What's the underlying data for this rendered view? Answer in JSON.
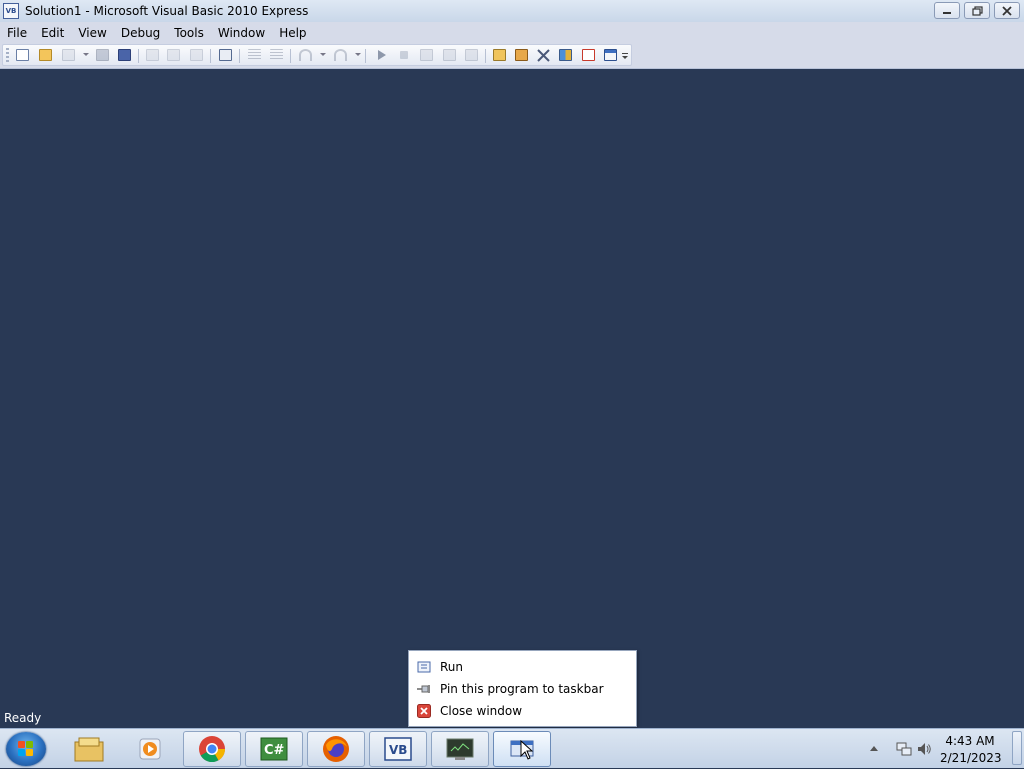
{
  "window": {
    "title": "Solution1 - Microsoft Visual Basic 2010 Express",
    "icon": "vb-app-icon",
    "icon_text": "VB",
    "buttons": {
      "minimize": "minimize-icon",
      "restore": "restore-icon",
      "close": "close-icon"
    }
  },
  "menu": {
    "items": [
      "File",
      "Edit",
      "View",
      "Debug",
      "Tools",
      "Window",
      "Help"
    ]
  },
  "toolbar": {
    "buttons": [
      "new-project-icon",
      "open-file-icon",
      "add-item-icon",
      "save-icon",
      "save-all-icon",
      "cut-icon",
      "copy-icon",
      "paste-icon",
      "find-in-files-icon",
      "comment-icon",
      "uncomment-icon",
      "undo-icon",
      "redo-icon",
      "start-debugging-icon",
      "stop-debugging-icon",
      "step-into-icon",
      "step-over-icon",
      "step-out-icon",
      "find-symbol-icon",
      "object-browser-icon",
      "toolbox-icon",
      "properties-icon",
      "extension-manager-icon",
      "start-page-icon",
      "toolbar-options-icon"
    ]
  },
  "status": {
    "text": "Ready"
  },
  "jumplist": {
    "items": [
      {
        "label": "Run",
        "icon": "run-program-icon"
      },
      {
        "label": "Pin this program to taskbar",
        "icon": "pin-icon"
      },
      {
        "label": "Close window",
        "icon": "close-window-icon"
      }
    ]
  },
  "taskbar": {
    "start": "windows-start-icon",
    "items": [
      {
        "name": "windows-explorer-icon",
        "running": false
      },
      {
        "name": "media-player-icon",
        "running": false
      },
      {
        "name": "chrome-icon",
        "running": true
      },
      {
        "name": "csharp-express-icon",
        "running": true
      },
      {
        "name": "firefox-icon",
        "running": true
      },
      {
        "name": "vb-express-icon",
        "running": true
      },
      {
        "name": "console-app-icon",
        "running": true
      },
      {
        "name": "running-program-icon",
        "running": true,
        "active": true
      }
    ],
    "tray": {
      "icons": [
        "show-hidden-icons-arrow",
        "network-icon",
        "volume-icon"
      ],
      "time": "4:43 AM",
      "date": "2/21/2023"
    }
  },
  "colors": {
    "workspace": "#293955",
    "titlebar": "#dfe8f4",
    "menubar": "#d6dbe9",
    "status_text": "#ffffff",
    "taskbar": "#c3d2e6"
  }
}
